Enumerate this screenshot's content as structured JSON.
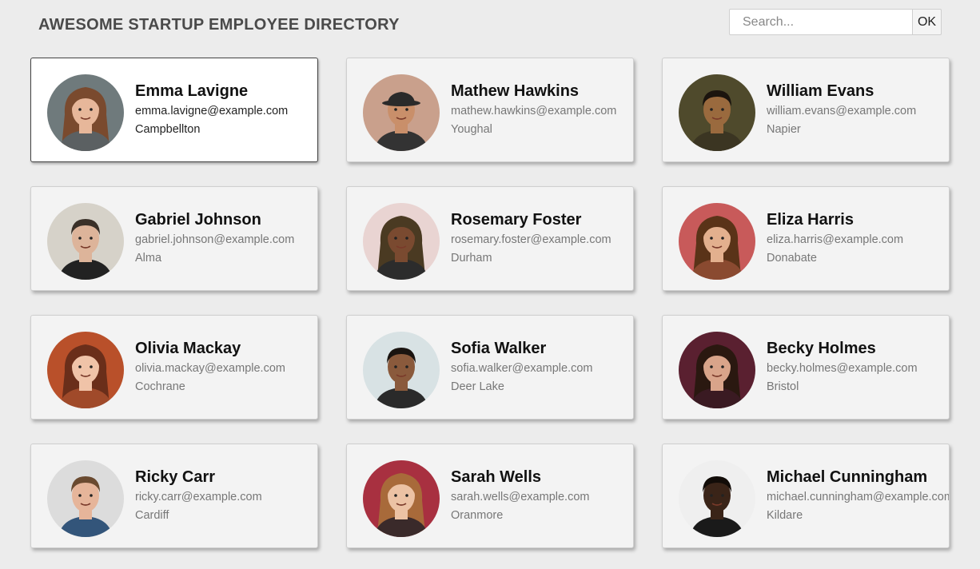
{
  "header": {
    "title": "AWESOME STARTUP EMPLOYEE DIRECTORY",
    "search_placeholder": "Search...",
    "search_value": "",
    "ok_label": "OK"
  },
  "employees": [
    {
      "name": "Emma Lavigne",
      "email": "emma.lavigne@example.com",
      "city": "Campbellton",
      "active": true,
      "avatar": {
        "bg": "#6f7a7c",
        "skin": "#e7b79a",
        "hair": "#7a4a2e",
        "shirt": "#5b6062",
        "style": "long"
      }
    },
    {
      "name": "Mathew Hawkins",
      "email": "mathew.hawkins@example.com",
      "city": "Youghal",
      "active": false,
      "avatar": {
        "bg": "#c9a08c",
        "skin": "#c98f6a",
        "hair": "#2a2a2a",
        "shirt": "#333333",
        "style": "hat"
      }
    },
    {
      "name": "William Evans",
      "email": "william.evans@example.com",
      "city": "Napier",
      "active": false,
      "avatar": {
        "bg": "#4f4a2c",
        "skin": "#9a6a3e",
        "hair": "#1b140e",
        "shirt": "#3b3522",
        "style": "short"
      }
    },
    {
      "name": "Gabriel Johnson",
      "email": "gabriel.johnson@example.com",
      "city": "Alma",
      "active": false,
      "avatar": {
        "bg": "#d6d2c9",
        "skin": "#ddb49a",
        "hair": "#3a3028",
        "shirt": "#222222",
        "style": "short"
      }
    },
    {
      "name": "Rosemary Foster",
      "email": "rosemary.foster@example.com",
      "city": "Durham",
      "active": false,
      "avatar": {
        "bg": "#e9d4d2",
        "skin": "#7a4a30",
        "hair": "#4a3a22",
        "shirt": "#2c2c2c",
        "style": "long"
      }
    },
    {
      "name": "Eliza Harris",
      "email": "eliza.harris@example.com",
      "city": "Donabate",
      "active": false,
      "avatar": {
        "bg": "#c85a5a",
        "skin": "#e3b08e",
        "hair": "#5a3318",
        "shirt": "#8a4a30",
        "style": "long"
      }
    },
    {
      "name": "Olivia Mackay",
      "email": "olivia.mackay@example.com",
      "city": "Cochrane",
      "active": false,
      "avatar": {
        "bg": "#b9502a",
        "skin": "#f0c3a8",
        "hair": "#6a2e1a",
        "shirt": "#a04a2a",
        "style": "long"
      }
    },
    {
      "name": "Sofia Walker",
      "email": "sofia.walker@example.com",
      "city": "Deer Lake",
      "active": false,
      "avatar": {
        "bg": "#d8e2e4",
        "skin": "#8a5a3c",
        "hair": "#1a1410",
        "shirt": "#2a2a2a",
        "style": "short"
      }
    },
    {
      "name": "Becky Holmes",
      "email": "becky.holmes@example.com",
      "city": "Bristol",
      "active": false,
      "avatar": {
        "bg": "#5a2030",
        "skin": "#d9a48a",
        "hair": "#2a1810",
        "shirt": "#3a1a22",
        "style": "long"
      }
    },
    {
      "name": "Ricky Carr",
      "email": "ricky.carr@example.com",
      "city": "Cardiff",
      "active": false,
      "avatar": {
        "bg": "#dcdcdc",
        "skin": "#e6b59a",
        "hair": "#6a4a30",
        "shirt": "#33557a",
        "style": "short"
      }
    },
    {
      "name": "Sarah Wells",
      "email": "sarah.wells@example.com",
      "city": "Oranmore",
      "active": false,
      "avatar": {
        "bg": "#a83040",
        "skin": "#ecc2a4",
        "hair": "#a86a3a",
        "shirt": "#3a2a2a",
        "style": "long"
      }
    },
    {
      "name": "Michael Cunningham",
      "email": "michael.cunningham@example.com",
      "city": "Kildare",
      "active": false,
      "avatar": {
        "bg": "#efefef",
        "skin": "#3a2418",
        "hair": "#120c08",
        "shirt": "#1a1a1a",
        "style": "short"
      }
    }
  ]
}
